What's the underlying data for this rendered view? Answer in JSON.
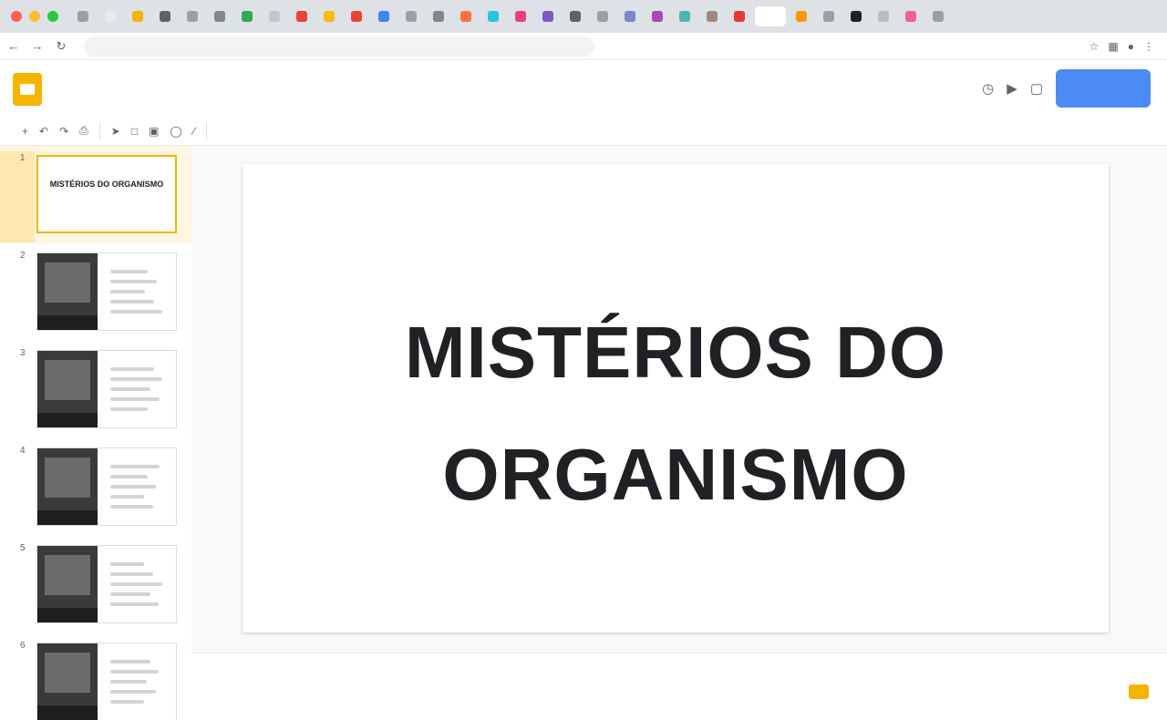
{
  "browser": {
    "window_dots": [
      "#ff5f57",
      "#febc2e",
      "#28c840"
    ],
    "tab_favicons": [
      "#9aa0a6",
      "#e8eaed",
      "#f4b400",
      "#5f6368",
      "#9aa0a6",
      "#80868b",
      "#34a853",
      "#c6c6c6",
      "#ea4335",
      "#fbbc04",
      "#ea4335",
      "#4285f4",
      "#9aa0a6",
      "#80868b",
      "#ff7043",
      "#26c6da",
      "#ec407a",
      "#7e57c2",
      "#5f6368",
      "#9aa0a6",
      "#7986cb",
      "#ab47bc",
      "#4db6ac",
      "#a1887f",
      "#e53935",
      "#ffffff",
      "#ff9800",
      "#9aa0a6",
      "#212121",
      "#bdbdbd",
      "#f06292",
      "#9e9e9e"
    ],
    "active_tab_index": 25,
    "address_text": "",
    "nav_icons": [
      "back-icon",
      "forward-icon",
      "reload-icon"
    ]
  },
  "app": {
    "title": "",
    "menu_items": [
      "",
      "",
      "",
      "",
      "",
      "",
      ""
    ],
    "share_label": "",
    "header_icons": [
      "history-icon",
      "present-icon",
      "comment-icon"
    ],
    "accent": "#f4b400",
    "share_color": "#4c8bf5"
  },
  "toolbar": {
    "tools": [
      "",
      "",
      "",
      "",
      "",
      "",
      "",
      "",
      ""
    ]
  },
  "filmstrip": {
    "slides": [
      {
        "number": "1",
        "selected": true,
        "title": "MISTÉRIOS DO ORGANISMO"
      },
      {
        "number": "2",
        "selected": false
      },
      {
        "number": "3",
        "selected": false
      },
      {
        "number": "4",
        "selected": false
      },
      {
        "number": "5",
        "selected": false
      },
      {
        "number": "6",
        "selected": false
      }
    ]
  },
  "slide": {
    "title_line1": "MISTÉRIOS DO",
    "title_line2": "ORGANISMO",
    "link_text": ""
  },
  "notes": {
    "placeholder": "",
    "expand_label": ""
  }
}
